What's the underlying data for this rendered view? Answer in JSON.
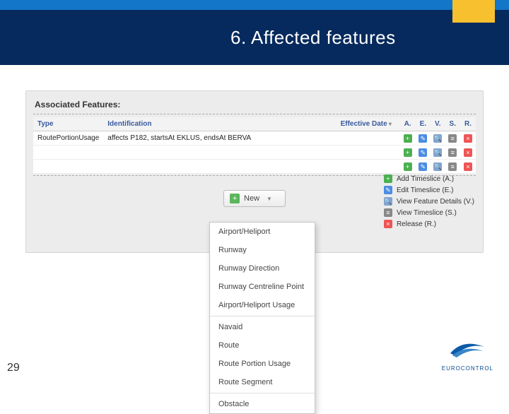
{
  "band_title": "6. Affected features",
  "panel_title": "Associated Features:",
  "columns": {
    "type": "Type",
    "ident": "Identification",
    "eff": "Effective Date",
    "a": "A.",
    "e": "E.",
    "v": "V.",
    "s": "S.",
    "r": "R."
  },
  "rows": [
    {
      "type": "RoutePortionUsage",
      "ident": "affects P182, startsAt EKLUS, endsAt BERVA",
      "eff": ""
    },
    {
      "type": "",
      "ident": "",
      "eff": ""
    },
    {
      "type": "",
      "ident": "",
      "eff": ""
    }
  ],
  "new_button": "New",
  "legend": {
    "add": "Add Timeslice (A.)",
    "edit": "Edit Timeslice (E.)",
    "view": "View Feature Details (V.)",
    "slice": "View Timeslice (S.)",
    "release": "Release (R.)"
  },
  "dropdown_groups": [
    [
      "Airport/Heliport",
      "Runway",
      "Runway Direction",
      "Runway Centreline Point",
      "Airport/Heliport Usage"
    ],
    [
      "Navaid",
      "Route",
      "Route Portion Usage",
      "Route Segment"
    ],
    [
      "Obstacle"
    ]
  ],
  "page_number": "29",
  "brand": "EUROCONTROL"
}
